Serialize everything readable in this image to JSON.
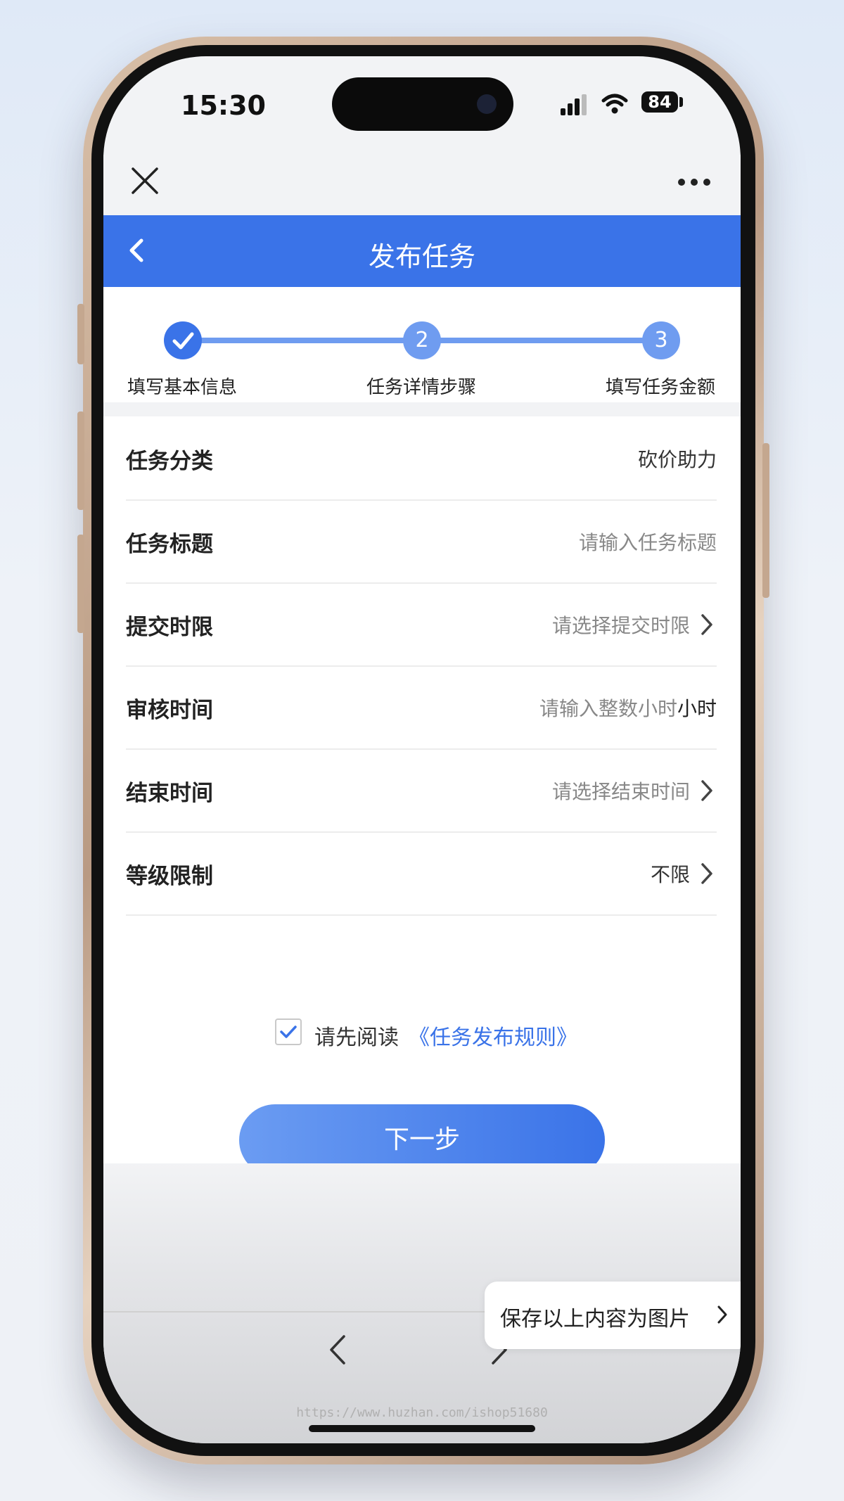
{
  "status": {
    "time": "15:30",
    "battery": "84"
  },
  "header": {
    "title": "发布任务"
  },
  "steps": [
    {
      "number": "",
      "label": "填写基本信息",
      "state": "done"
    },
    {
      "number": "2",
      "label": "任务详情步骤",
      "state": "pending"
    },
    {
      "number": "3",
      "label": "填写任务金额",
      "state": "pending"
    }
  ],
  "form": {
    "rows": [
      {
        "label": "任务分类",
        "value": "砍价助力"
      },
      {
        "label": "任务标题",
        "placeholder": "请输入任务标题"
      },
      {
        "label": "提交时限",
        "placeholder": "请选择提交时限"
      },
      {
        "label": "审核时间",
        "placeholder": "请输入整数小时",
        "unit": "小时"
      },
      {
        "label": "结束时间",
        "placeholder": "请选择结束时间"
      },
      {
        "label": "等级限制",
        "value": "不限"
      }
    ]
  },
  "agreement": {
    "text": "请先阅读",
    "link": "《任务发布规则》",
    "checked": true
  },
  "next_button": "下一步",
  "save_image": "保存以上内容为图片",
  "watermark": "https://www.huzhan.com/ishop51680",
  "colors": {
    "primary": "#3a73e8",
    "step_pending": "#6f9cf0"
  }
}
